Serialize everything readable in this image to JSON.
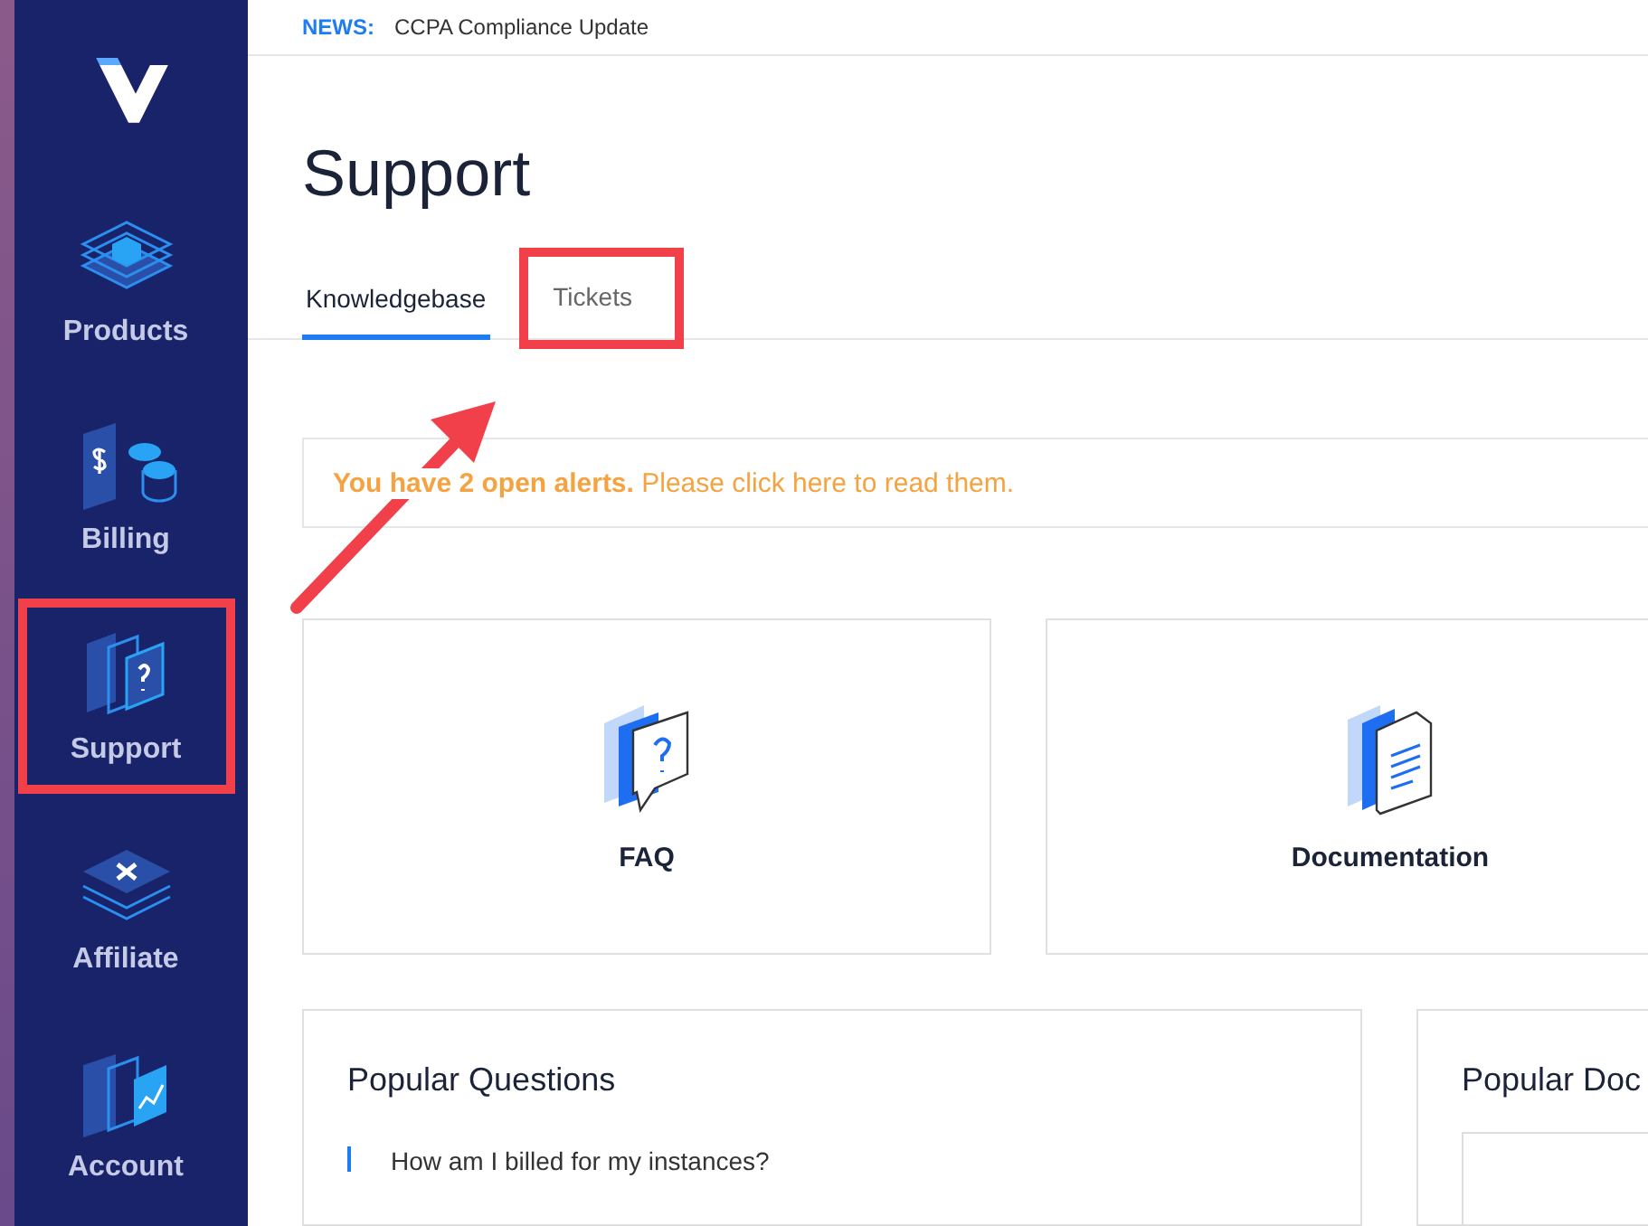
{
  "sidebar": {
    "items": [
      {
        "label": "Products",
        "kind": "products",
        "highlighted": false
      },
      {
        "label": "Billing",
        "kind": "billing",
        "highlighted": false
      },
      {
        "label": "Support",
        "kind": "support",
        "highlighted": true
      },
      {
        "label": "Affiliate",
        "kind": "affiliate",
        "highlighted": false
      },
      {
        "label": "Account",
        "kind": "account",
        "highlighted": false
      }
    ]
  },
  "news": {
    "label": "NEWS:",
    "text": "CCPA Compliance Update"
  },
  "page_title": "Support",
  "tabs": [
    {
      "label": "Knowledgebase",
      "selected": true,
      "highlighted": false
    },
    {
      "label": "Tickets",
      "selected": false,
      "highlighted": true
    }
  ],
  "alert": {
    "text": "**You have 2 open alerts.** Please click here to read them."
  },
  "cards": [
    {
      "title": "FAQ",
      "kind": "faq"
    },
    {
      "title": "Documentation",
      "kind": "docs"
    }
  ],
  "panels": [
    {
      "title": "Popular Questions",
      "kind": "list",
      "items": [
        "How am I billed for my instances?"
      ]
    },
    {
      "title": "Popular Doc",
      "kind": "search"
    }
  ]
}
